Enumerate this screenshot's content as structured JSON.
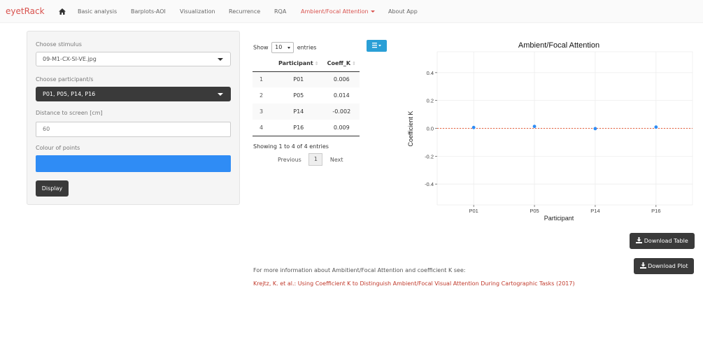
{
  "navbar": {
    "brand": "eyetRack",
    "items": [
      {
        "label": "Basic analysis"
      },
      {
        "label": "Barplots-AOI"
      },
      {
        "label": "Visualization"
      },
      {
        "label": "Recurrence"
      },
      {
        "label": "RQA"
      },
      {
        "label": "Ambient/Focal Attention"
      },
      {
        "label": "About App"
      }
    ]
  },
  "sidebar": {
    "stimulus_label": "Choose stimulus",
    "stimulus_value": "09-M1-CX-SI-VE.jpg",
    "participants_label": "Choose participant/s",
    "participants_value": "P01, P05, P14, P16",
    "distance_label": "Distance to screen [cm]",
    "distance_value": "60",
    "colour_label": "Colour of points",
    "colour_value": "#2f8cf5",
    "display_label": "Display"
  },
  "table": {
    "show_prefix": "Show",
    "show_value": "10",
    "show_suffix": "entries",
    "columns": [
      "",
      "Participant",
      "Coeff_K"
    ],
    "rows": [
      {
        "idx": "1",
        "participant": "P01",
        "k": "0.006"
      },
      {
        "idx": "2",
        "participant": "P05",
        "k": "0.014"
      },
      {
        "idx": "3",
        "participant": "P14",
        "k": "-0.002"
      },
      {
        "idx": "4",
        "participant": "P16",
        "k": "0.009"
      }
    ],
    "info": "Showing 1 to 4 of 4 entries",
    "prev": "Previous",
    "page": "1",
    "next": "Next"
  },
  "chart_data": {
    "type": "scatter",
    "title": "Ambient/Focal Attention",
    "xlabel": "Participant",
    "ylabel": "Coefficient K",
    "categories": [
      "P01",
      "P05",
      "P14",
      "P16"
    ],
    "values": [
      0.006,
      0.014,
      -0.002,
      0.009
    ],
    "ylim": [
      -0.55,
      0.55
    ],
    "yticks": [
      "0.4",
      "0.2",
      "0.0",
      "-0.2",
      "-0.4"
    ],
    "reference_line": 0,
    "point_color": "#2f8cf5",
    "reference_color": "#e8603c"
  },
  "footer": {
    "info_text": "For more information about Ambitient/Focal Attention and coefficient K see:",
    "reference": "Krejtz, K. et al.: Using Coefficient K to Distinguish Ambient/Focal Visual Attention During Cartographic Tasks (2017)"
  },
  "downloads": {
    "table": "Download Table",
    "plot": "Download Plot"
  }
}
